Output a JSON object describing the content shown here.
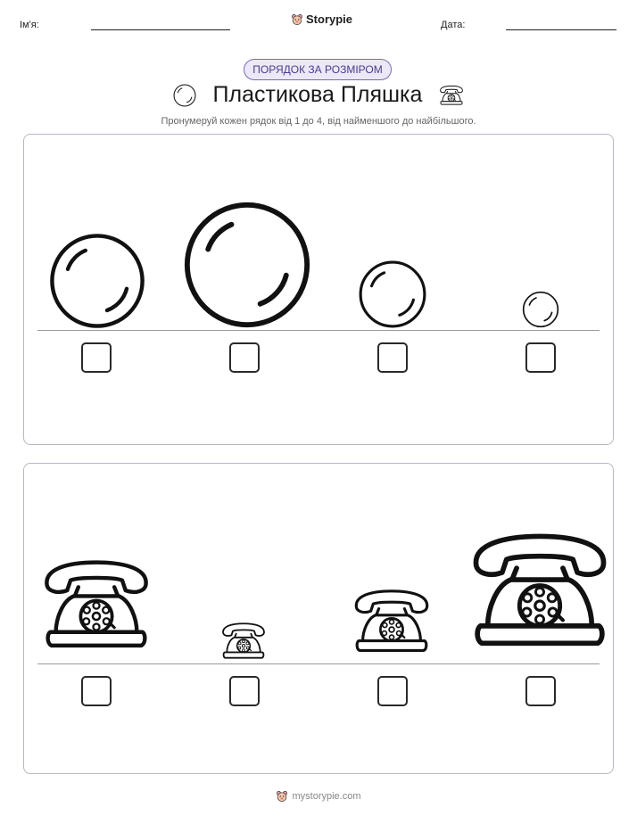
{
  "header": {
    "name_label": "Ім'я:",
    "brand": "Storypie",
    "date_label": "Дата:"
  },
  "worksheet": {
    "tag": "ПОРЯДОК ЗА РОЗМІРОМ",
    "title": "Пластикова Пляшка",
    "instruction": "Пронумеруй кожен рядок від 1 до 4, від найменшого до найбільшого."
  },
  "rows": [
    {
      "item_icon": "bubble-icon",
      "count": 4,
      "answers": [
        "",
        "",
        "",
        ""
      ]
    },
    {
      "item_icon": "rotary-telephone-icon",
      "count": 4,
      "answers": [
        "",
        "",
        "",
        ""
      ]
    }
  ],
  "footer": {
    "site": "mystorypie.com"
  },
  "colors": {
    "tag_bg": "#ece8f7",
    "tag_border": "#7c6bb0",
    "tag_text": "#4a3d86",
    "panel_border": "#b8b8c2"
  }
}
